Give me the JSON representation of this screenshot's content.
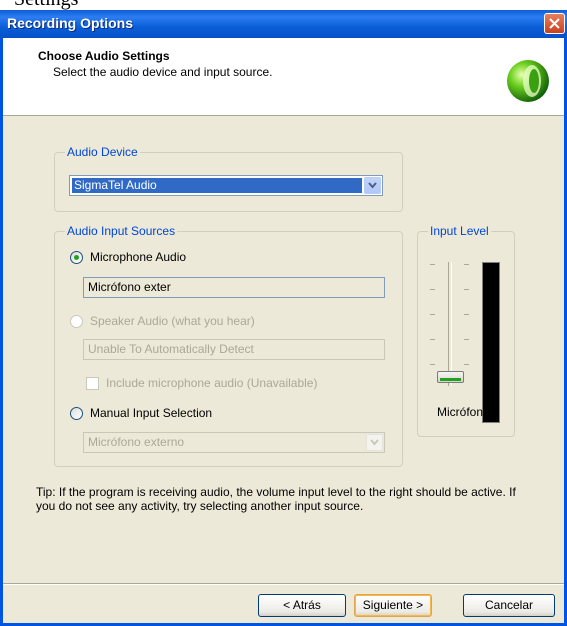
{
  "top_fragment": "Settings",
  "window": {
    "title": "Recording Options"
  },
  "header": {
    "title": "Choose Audio Settings",
    "subtitle": "Select the audio device and input source.",
    "logo_icon": "green-sphere-logo-icon"
  },
  "audio_device": {
    "legend": "Audio Device",
    "selected": "SigmaTel Audio"
  },
  "input_sources": {
    "legend": "Audio Input Sources",
    "microphone": {
      "label": "Microphone Audio",
      "value": "Micrófono exter",
      "checked": true
    },
    "speaker": {
      "label": "Speaker Audio (what you hear)",
      "value": "Unable To Automatically Detect",
      "enabled": false
    },
    "include_mic": {
      "label": "Include microphone audio (Unavailable)",
      "checked": false,
      "enabled": false
    },
    "manual": {
      "label": "Manual Input Selection",
      "selected": "Micrófono externo",
      "checked": false
    }
  },
  "input_level": {
    "legend": "Input Level",
    "caption": "Micrófono",
    "level": 0
  },
  "tip": "Tip: If the program is receiving audio, the volume input level to the right should be active.  If you do not see any activity, try selecting another input source.",
  "buttons": {
    "back": "< Atrás",
    "next": "Siguiente >",
    "cancel": "Cancelar"
  },
  "colors": {
    "title_bar": "#0a5fd8",
    "dialog_bg": "#ece9d8",
    "legend_text": "#0046d5",
    "selection": "#316ac5",
    "close_button": "#c9401f"
  }
}
